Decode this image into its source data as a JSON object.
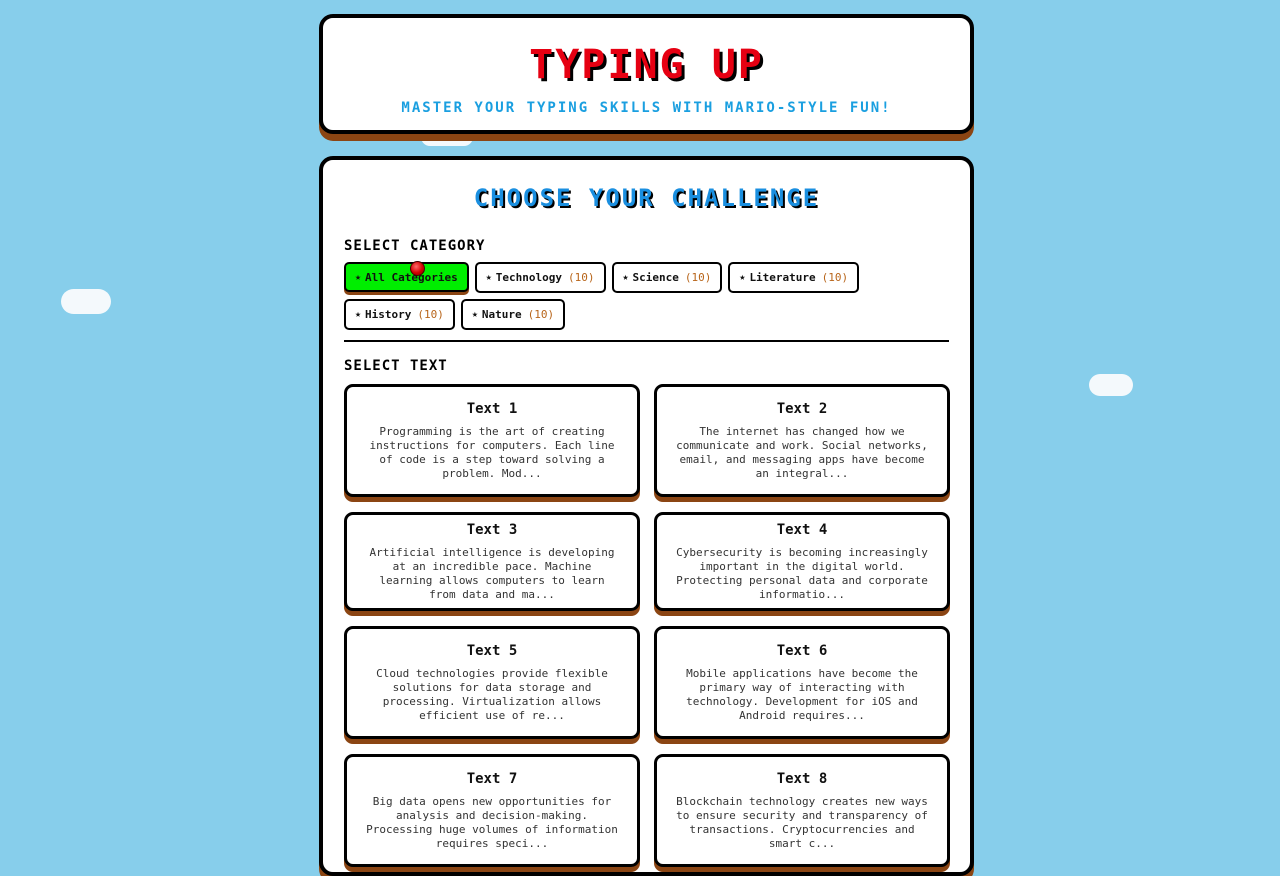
{
  "header": {
    "title": "TYPING UP",
    "subtitle": "MASTER YOUR TYPING SKILLS WITH MARIO-STYLE FUN!"
  },
  "main": {
    "section_title": "CHOOSE YOUR CHALLENGE",
    "category_label": "SELECT CATEGORY",
    "text_label": "SELECT TEXT",
    "categories": [
      {
        "label": "All Categories",
        "count": "",
        "active": true
      },
      {
        "label": "Technology",
        "count": "(10)"
      },
      {
        "label": "Science",
        "count": "(10)"
      },
      {
        "label": "Literature",
        "count": "(10)"
      },
      {
        "label": "History",
        "count": "(10)"
      },
      {
        "label": "Nature",
        "count": "(10)"
      }
    ],
    "star_glyph": "★",
    "texts": [
      {
        "title": "Text 1",
        "preview": "Programming is the art of creating instructions for computers. Each line of code is a step toward solving a problem. Mod..."
      },
      {
        "title": "Text 2",
        "preview": "The internet has changed how we communicate and work. Social networks, email, and messaging apps have become an integral..."
      },
      {
        "title": "Text 3",
        "preview": "Artificial intelligence is developing at an incredible pace. Machine learning allows computers to learn from data and ma..."
      },
      {
        "title": "Text 4",
        "preview": "Cybersecurity is becoming increasingly important in the digital world. Protecting personal data and corporate informatio..."
      },
      {
        "title": "Text 5",
        "preview": "Cloud technologies provide flexible solutions for data storage and processing. Virtualization allows efficient use of re..."
      },
      {
        "title": "Text 6",
        "preview": "Mobile applications have become the primary way of interacting with technology. Development for iOS and Android requires..."
      },
      {
        "title": "Text 7",
        "preview": "Big data opens new opportunities for analysis and decision-making. Processing huge volumes of information requires speci..."
      },
      {
        "title": "Text 8",
        "preview": "Blockchain technology creates new ways to ensure security and transparency of transactions. Cryptocurrencies and smart c..."
      }
    ]
  },
  "colors": {
    "sky": "#87ceeb",
    "title_red": "#e60012",
    "subtitle_blue": "#1a9fe0",
    "active_green": "#00ee00",
    "shadow_brown": "#8b4513"
  }
}
